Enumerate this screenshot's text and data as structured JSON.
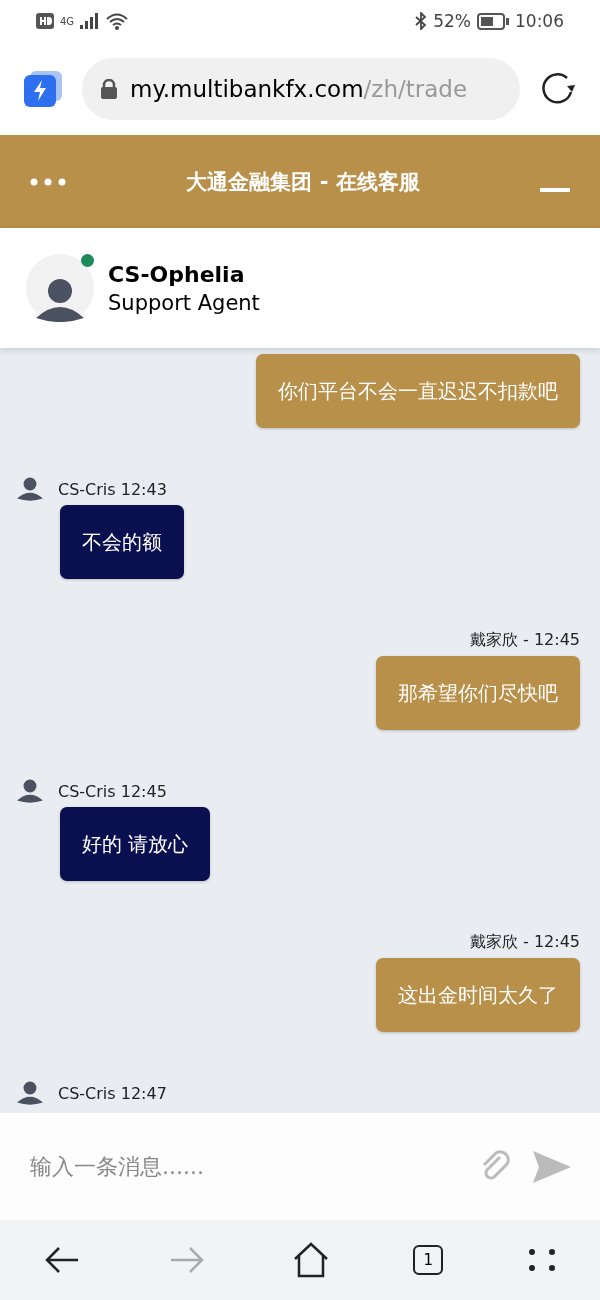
{
  "status_bar": {
    "network": "4G",
    "battery": "52%",
    "time": "10:06"
  },
  "browser": {
    "url_host": "my.multibankfx.com",
    "url_path": "/zh/trade"
  },
  "chat_header": {
    "title": "大通金融集团 - 在线客服"
  },
  "agent": {
    "name": "CS-Ophelia",
    "role": "Support Agent",
    "online": true
  },
  "messages": [
    {
      "kind": "user",
      "text": "你们平台不会一直迟迟不扣款吧"
    },
    {
      "kind": "agent",
      "meta": "CS-Cris 12:43",
      "text": "不会的额"
    },
    {
      "kind": "user",
      "meta": "戴家欣 - 12:45",
      "text": "那希望你们尽快吧"
    },
    {
      "kind": "agent",
      "meta": "CS-Cris 12:45",
      "text": "好的 请放心"
    },
    {
      "kind": "user",
      "meta": "戴家欣 - 12:45",
      "text": "这出金时间太久了"
    },
    {
      "kind": "agent",
      "meta": "CS-Cris 12:47"
    }
  ],
  "composer": {
    "placeholder": "输入一条消息......"
  },
  "nav": {
    "tab_count": "1",
    "forward_disabled": true
  }
}
